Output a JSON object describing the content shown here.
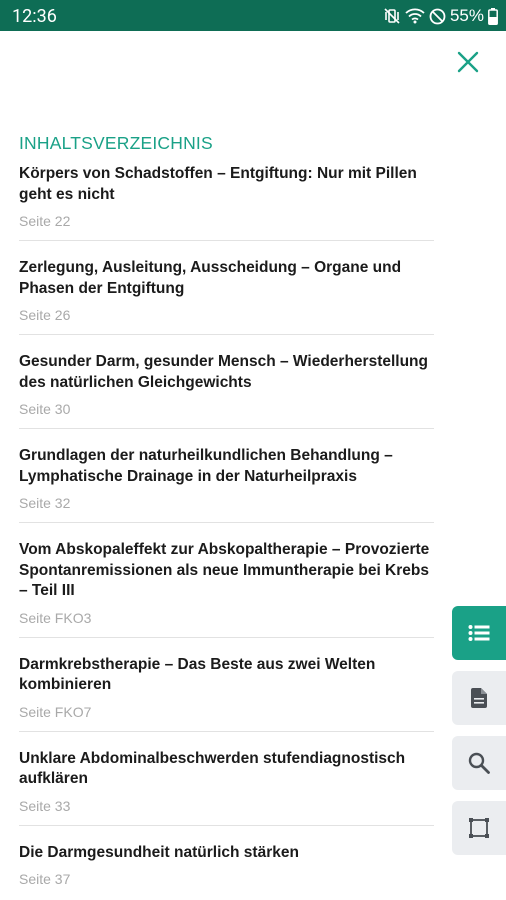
{
  "status_bar": {
    "time": "12:36",
    "battery": "55%"
  },
  "heading": "INHALTSVERZEICHNIS",
  "toc": [
    {
      "title": "Körpers von Schadstoffen – Entgiftung: Nur mit Pillen geht es nicht",
      "page": "Seite 22"
    },
    {
      "title": "Zerlegung, Ausleitung, Ausscheidung – Organe und Phasen der Entgiftung",
      "page": "Seite 26"
    },
    {
      "title": "Gesunder Darm, gesunder Mensch – Wiederherstellung des natürlichen Gleichgewichts",
      "page": "Seite 30"
    },
    {
      "title": "Grundlagen der naturheilkundlichen Behandlung –Lymphatische Drainage in der Naturheilpraxis",
      "page": "Seite 32"
    },
    {
      "title": "Vom Abskopaleffekt zur Abskopaltherapie – Provozierte Spontanremissionen als neue Immuntherapie bei Krebs – Teil III",
      "page": "Seite FKO3"
    },
    {
      "title": "Darmkrebstherapie – Das Beste aus zwei Welten kombinieren",
      "page": "Seite FKO7"
    },
    {
      "title": "Unklare Abdominalbeschwerden stufendiagnostisch aufklären",
      "page": "Seite 33"
    },
    {
      "title": "Die Darmgesundheit natürlich stärken",
      "page": "Seite 37"
    }
  ],
  "sidebar_icons": [
    "list-icon",
    "document-icon",
    "search-icon",
    "crop-icon"
  ],
  "colors": {
    "accent": "#1aa187",
    "status_bar": "#0e6d55"
  }
}
